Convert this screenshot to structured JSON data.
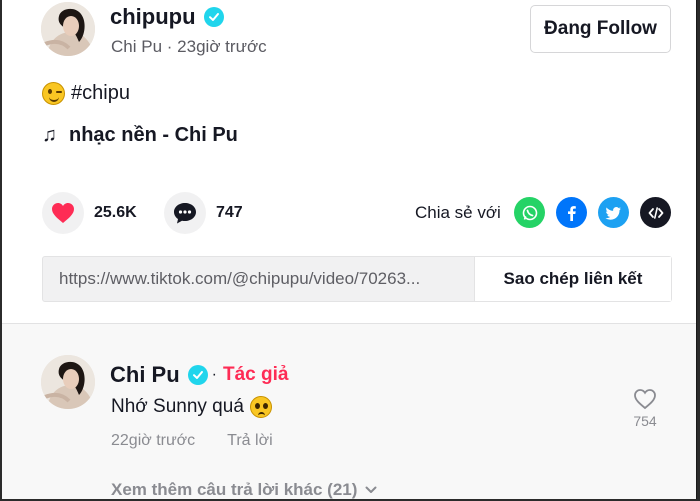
{
  "post": {
    "handle": "chipupu",
    "display_name": "Chi Pu",
    "separator": "·",
    "time_ago": "23giờ trước",
    "follow_label": "Đang Follow",
    "caption_tag": "#chipu",
    "music": "nhạc nền - Chi Pu",
    "likes": "25.6K",
    "comments_count": "747",
    "share_label": "Chia sẻ với",
    "link": "https://www.tiktok.com/@chipupu/video/70263...",
    "copy_label": "Sao chép liên kết"
  },
  "comment": {
    "author": "Chi Pu",
    "dot": "·",
    "author_badge": "Tác giả",
    "text": "Nhớ Sunny quá",
    "time_ago": "22giờ trước",
    "reply_label": "Trả lời",
    "likes": "754",
    "more_replies": "Xem thêm câu trả lời khác (21)"
  },
  "icons": {
    "verified": "verified-badge-icon",
    "heart": "heart-icon",
    "comment": "comment-bubble-icon",
    "whatsapp": "whatsapp-icon",
    "facebook": "facebook-icon",
    "twitter": "twitter-icon",
    "embed": "embed-code-icon",
    "music": "music-note-icon",
    "chevron": "chevron-down-icon"
  },
  "colors": {
    "accent_red": "#fe2c55",
    "verified_cyan": "#20d5ec",
    "whatsapp": "#25d366",
    "facebook": "#0075fa",
    "twitter": "#1da1f2",
    "embed": "#161823"
  }
}
